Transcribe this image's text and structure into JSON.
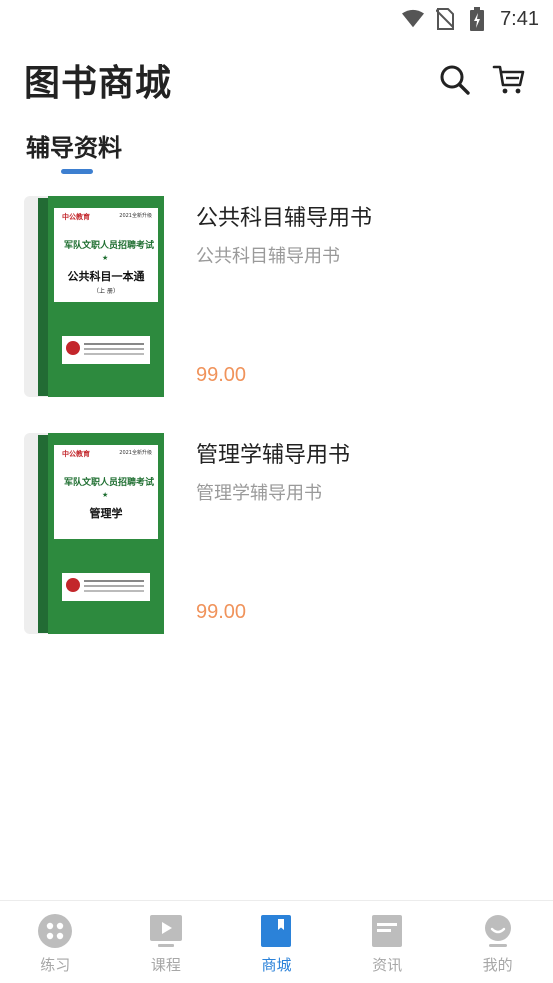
{
  "status_bar": {
    "time": "7:41",
    "icons": [
      "wifi-icon",
      "no-sim-icon",
      "battery-charging-icon"
    ]
  },
  "header": {
    "title": "图书商城",
    "search_icon": "search-icon",
    "cart_icon": "cart-icon"
  },
  "section": {
    "label": "辅导资料",
    "accent_color": "#3d7fd0"
  },
  "products": [
    {
      "name": "公共科目辅导用书",
      "description": "公共科目辅导用书",
      "price": "99.00",
      "cover": {
        "brand": "中公教育",
        "year": "2021全新升级",
        "series": "军队文职人员招聘考试",
        "subject": "公共科目一本通",
        "volume": "（上 册）"
      }
    },
    {
      "name": "管理学辅导用书",
      "description": "管理学辅导用书",
      "price": "99.00",
      "cover": {
        "brand": "中公教育",
        "year": "2021全新升级",
        "series": "军队文职人员招聘考试",
        "subject": "管理学",
        "volume": ""
      }
    }
  ],
  "tab_bar": {
    "active_color": "#2b82d9",
    "inactive_color": "#a7a7a7",
    "tabs": [
      {
        "label": "练习",
        "icon": "practice-icon",
        "active": false
      },
      {
        "label": "课程",
        "icon": "course-play-icon",
        "active": false
      },
      {
        "label": "商城",
        "icon": "bookstore-icon",
        "active": true
      },
      {
        "label": "资讯",
        "icon": "news-icon",
        "active": false
      },
      {
        "label": "我的",
        "icon": "profile-icon",
        "active": false
      }
    ]
  }
}
